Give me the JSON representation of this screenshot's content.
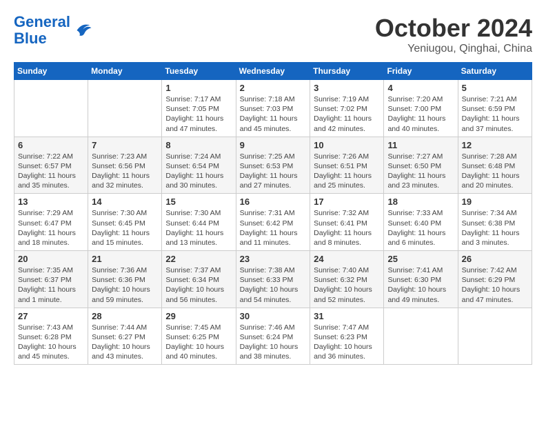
{
  "header": {
    "logo": {
      "line1": "General",
      "line2": "Blue"
    },
    "title": "October 2024",
    "location": "Yeniugou, Qinghai, China"
  },
  "weekdays": [
    "Sunday",
    "Monday",
    "Tuesday",
    "Wednesday",
    "Thursday",
    "Friday",
    "Saturday"
  ],
  "weeks": [
    [
      null,
      null,
      {
        "day": 1,
        "sunrise": "7:17 AM",
        "sunset": "7:05 PM",
        "daylight": "11 hours and 47 minutes."
      },
      {
        "day": 2,
        "sunrise": "7:18 AM",
        "sunset": "7:03 PM",
        "daylight": "11 hours and 45 minutes."
      },
      {
        "day": 3,
        "sunrise": "7:19 AM",
        "sunset": "7:02 PM",
        "daylight": "11 hours and 42 minutes."
      },
      {
        "day": 4,
        "sunrise": "7:20 AM",
        "sunset": "7:00 PM",
        "daylight": "11 hours and 40 minutes."
      },
      {
        "day": 5,
        "sunrise": "7:21 AM",
        "sunset": "6:59 PM",
        "daylight": "11 hours and 37 minutes."
      }
    ],
    [
      {
        "day": 6,
        "sunrise": "7:22 AM",
        "sunset": "6:57 PM",
        "daylight": "11 hours and 35 minutes."
      },
      {
        "day": 7,
        "sunrise": "7:23 AM",
        "sunset": "6:56 PM",
        "daylight": "11 hours and 32 minutes."
      },
      {
        "day": 8,
        "sunrise": "7:24 AM",
        "sunset": "6:54 PM",
        "daylight": "11 hours and 30 minutes."
      },
      {
        "day": 9,
        "sunrise": "7:25 AM",
        "sunset": "6:53 PM",
        "daylight": "11 hours and 27 minutes."
      },
      {
        "day": 10,
        "sunrise": "7:26 AM",
        "sunset": "6:51 PM",
        "daylight": "11 hours and 25 minutes."
      },
      {
        "day": 11,
        "sunrise": "7:27 AM",
        "sunset": "6:50 PM",
        "daylight": "11 hours and 23 minutes."
      },
      {
        "day": 12,
        "sunrise": "7:28 AM",
        "sunset": "6:48 PM",
        "daylight": "11 hours and 20 minutes."
      }
    ],
    [
      {
        "day": 13,
        "sunrise": "7:29 AM",
        "sunset": "6:47 PM",
        "daylight": "11 hours and 18 minutes."
      },
      {
        "day": 14,
        "sunrise": "7:30 AM",
        "sunset": "6:45 PM",
        "daylight": "11 hours and 15 minutes."
      },
      {
        "day": 15,
        "sunrise": "7:30 AM",
        "sunset": "6:44 PM",
        "daylight": "11 hours and 13 minutes."
      },
      {
        "day": 16,
        "sunrise": "7:31 AM",
        "sunset": "6:42 PM",
        "daylight": "11 hours and 11 minutes."
      },
      {
        "day": 17,
        "sunrise": "7:32 AM",
        "sunset": "6:41 PM",
        "daylight": "11 hours and 8 minutes."
      },
      {
        "day": 18,
        "sunrise": "7:33 AM",
        "sunset": "6:40 PM",
        "daylight": "11 hours and 6 minutes."
      },
      {
        "day": 19,
        "sunrise": "7:34 AM",
        "sunset": "6:38 PM",
        "daylight": "11 hours and 3 minutes."
      }
    ],
    [
      {
        "day": 20,
        "sunrise": "7:35 AM",
        "sunset": "6:37 PM",
        "daylight": "11 hours and 1 minute."
      },
      {
        "day": 21,
        "sunrise": "7:36 AM",
        "sunset": "6:36 PM",
        "daylight": "10 hours and 59 minutes."
      },
      {
        "day": 22,
        "sunrise": "7:37 AM",
        "sunset": "6:34 PM",
        "daylight": "10 hours and 56 minutes."
      },
      {
        "day": 23,
        "sunrise": "7:38 AM",
        "sunset": "6:33 PM",
        "daylight": "10 hours and 54 minutes."
      },
      {
        "day": 24,
        "sunrise": "7:40 AM",
        "sunset": "6:32 PM",
        "daylight": "10 hours and 52 minutes."
      },
      {
        "day": 25,
        "sunrise": "7:41 AM",
        "sunset": "6:30 PM",
        "daylight": "10 hours and 49 minutes."
      },
      {
        "day": 26,
        "sunrise": "7:42 AM",
        "sunset": "6:29 PM",
        "daylight": "10 hours and 47 minutes."
      }
    ],
    [
      {
        "day": 27,
        "sunrise": "7:43 AM",
        "sunset": "6:28 PM",
        "daylight": "10 hours and 45 minutes."
      },
      {
        "day": 28,
        "sunrise": "7:44 AM",
        "sunset": "6:27 PM",
        "daylight": "10 hours and 43 minutes."
      },
      {
        "day": 29,
        "sunrise": "7:45 AM",
        "sunset": "6:25 PM",
        "daylight": "10 hours and 40 minutes."
      },
      {
        "day": 30,
        "sunrise": "7:46 AM",
        "sunset": "6:24 PM",
        "daylight": "10 hours and 38 minutes."
      },
      {
        "day": 31,
        "sunrise": "7:47 AM",
        "sunset": "6:23 PM",
        "daylight": "10 hours and 36 minutes."
      },
      null,
      null
    ]
  ]
}
